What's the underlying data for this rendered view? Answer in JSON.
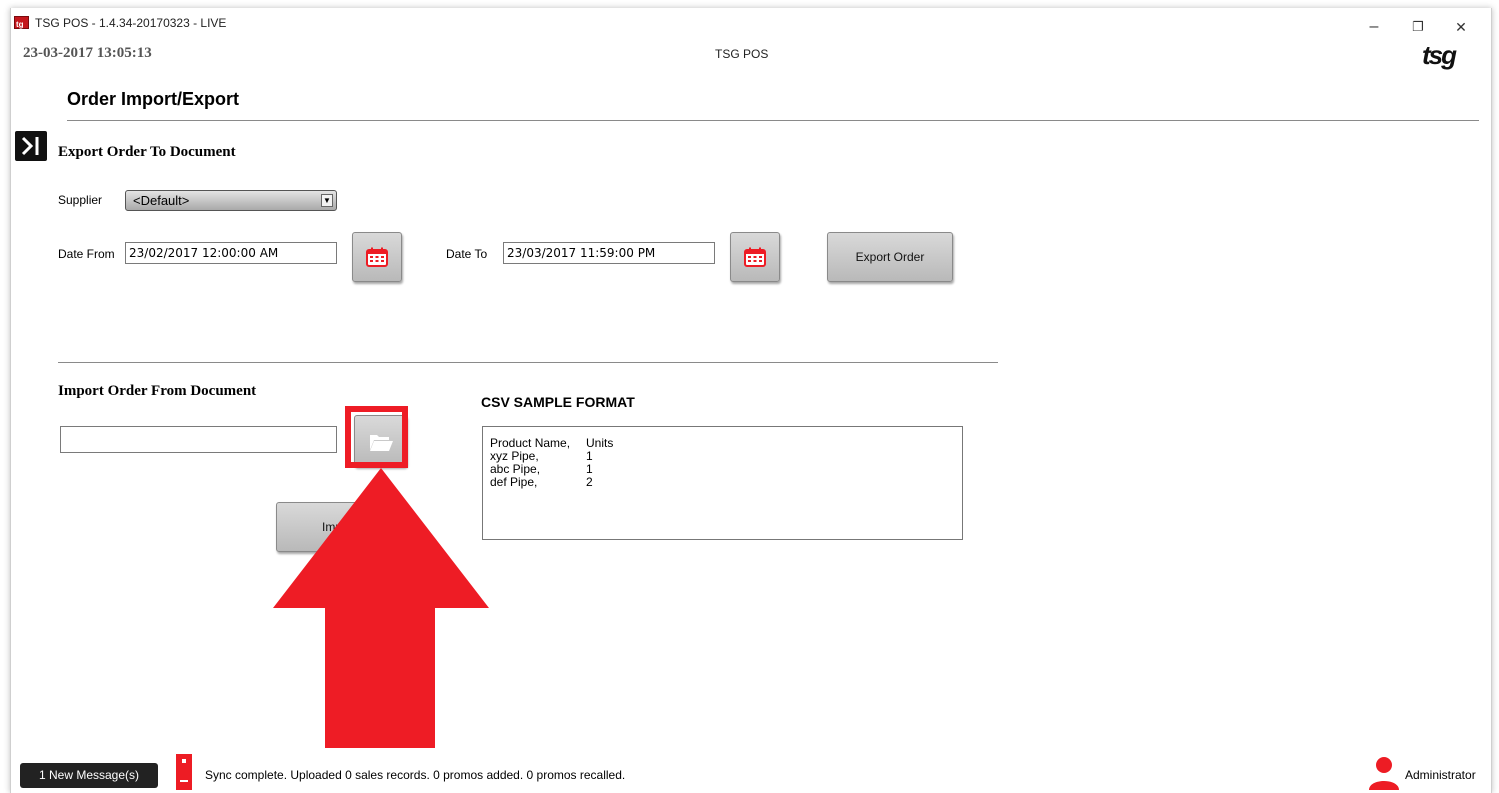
{
  "window": {
    "title": "TSG POS - 1.4.34-20170323 - LIVE",
    "minimize": "–",
    "restore": "❐",
    "close": "✕"
  },
  "header": {
    "datetime": "23-03-2017 13:05:13",
    "center_title": "TSG POS",
    "logo": "tsg"
  },
  "page": {
    "title": "Order Import/Export"
  },
  "export_section": {
    "heading": "Export Order To Document",
    "supplier_label": "Supplier",
    "supplier_value": "<Default>",
    "date_from_label": "Date From",
    "date_from_value": "23/02/2017 12:00:00 AM",
    "date_to_label": "Date To",
    "date_to_value": "23/03/2017 11:59:00 PM",
    "export_button": "Export Order"
  },
  "import_section": {
    "heading": "Import Order From Document",
    "file_value": "",
    "import_button": "Import",
    "csv_heading": "CSV SAMPLE FORMAT",
    "csv_rows": [
      [
        "Product Name,",
        "Units"
      ],
      [
        "xyz Pipe,",
        "1"
      ],
      [
        "abc Pipe,",
        "1"
      ],
      [
        "def Pipe,",
        "2"
      ]
    ]
  },
  "status_bar": {
    "messages_button": "1 New Message(s)",
    "sync_text": "Sync complete.  Uploaded 0 sales records. 0 promos added. 0 promos recalled.",
    "user": "Administrator"
  },
  "colors": {
    "accent_red": "#ed1c24",
    "arrow_red": "#ee1c25",
    "button_gray": "#c8c8c8"
  },
  "icons": {
    "app": "tsg-app-icon",
    "collapse": "sidebar-expand-icon",
    "calendar": "calendar-icon",
    "folder": "folder-open-icon",
    "server": "server-icon",
    "user": "user-icon"
  }
}
